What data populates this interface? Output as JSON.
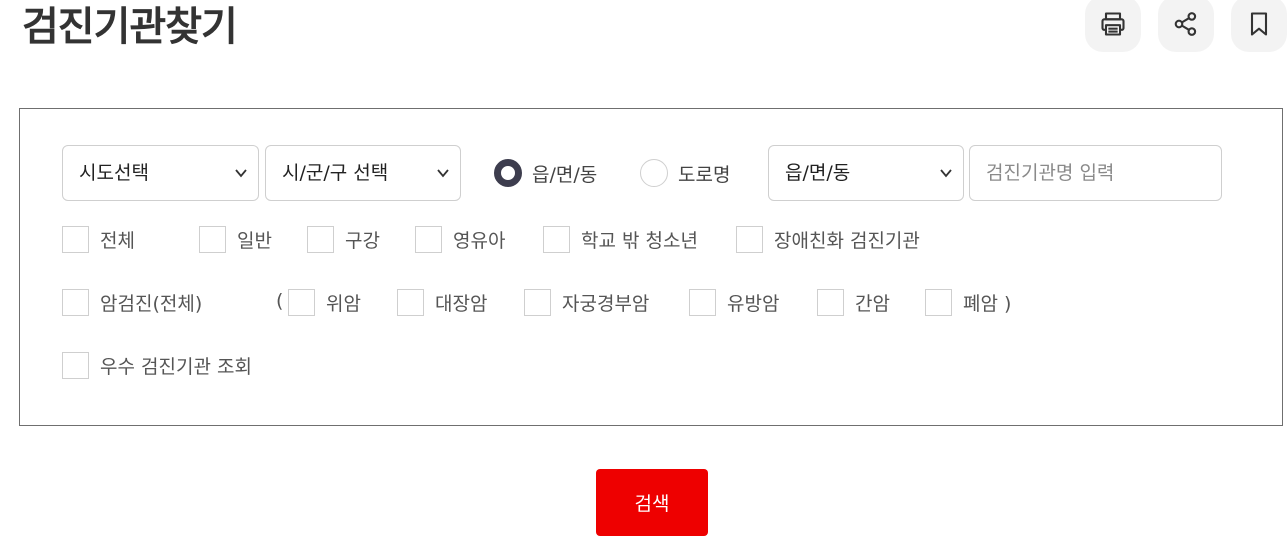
{
  "page": {
    "title": "검진기관찾기"
  },
  "actions": {
    "print_icon": "printer-icon",
    "share_icon": "share-icon",
    "bookmark_icon": "bookmark-icon"
  },
  "filters": {
    "sido_select": "시도선택",
    "sigungu_select": "시/군/구 선택",
    "address_type": {
      "options": [
        "읍/면/동",
        "도로명"
      ],
      "selected": "읍/면/동"
    },
    "dong_select": "읍/면/동",
    "name_input": {
      "placeholder": "검진기관명 입력",
      "value": ""
    },
    "categories": [
      "전체",
      "일반",
      "구강",
      "영유아",
      "학교 밖 청소년",
      "장애친화 검진기관"
    ],
    "cancer_all": "암검진(전체)",
    "paren_open": "(",
    "cancers": [
      "위암",
      "대장암",
      "자궁경부암",
      "유방암",
      "간암",
      "폐암 )"
    ],
    "excellent": "우수 검진기관 조회"
  },
  "search": {
    "label": "검색",
    "color": "#ee0000"
  }
}
